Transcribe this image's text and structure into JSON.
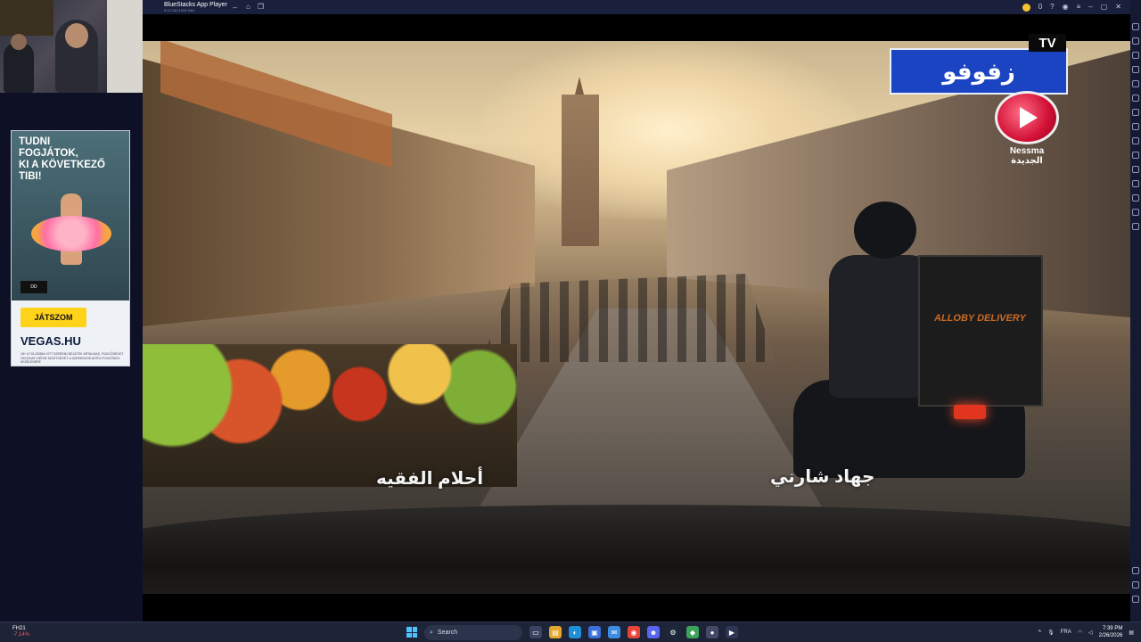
{
  "window": {
    "title": "BlueStacks App Player",
    "subtitle": "5.22.150.1028 N64",
    "coins": "0"
  },
  "icons": {
    "back": "back-arrow-icon",
    "home": "home-icon",
    "multi": "multi-instance-icon",
    "coin": "coin-icon",
    "help": "help-icon",
    "account": "account-icon",
    "menu": "menu-icon",
    "minimize": "minimize-icon",
    "restore": "restore-icon",
    "close": "close-icon"
  },
  "ad": {
    "headline": [
      "TUDNI",
      "FOGJÁTOK,",
      "KI A KÖVETKEZŐ",
      "TIBI!"
    ],
    "cta": "JÁTSZOM",
    "brand": "VEGAS.HU",
    "fine_print": "18+ A TÚLZÁSBA VITT SZERENCSEJÁTÉK ÁRTALMAS, FÜGGŐSÉGET OKOZHAT! KÉRJE SEGÍTSÉGÉT: A SZERENCSEJÁTÉK-FÜGGŐSÉG KEZELÉSÉRE"
  },
  "video": {
    "channel_logo": "زفوفو",
    "channel_tv": "TV",
    "broadcaster": "Nessma",
    "broadcaster_sub": "الجديدة",
    "caption_left": "أحلام الفقيه",
    "caption_right": "جهاد شارني",
    "delivery_box_label": "ALLOBY DELIVERY"
  },
  "taskbar": {
    "weather_value": "FH21",
    "weather_change": "-7,14%",
    "search_placeholder": "Search",
    "language": "FRA",
    "time": "7:39 PM",
    "date": "2/26/2026"
  }
}
